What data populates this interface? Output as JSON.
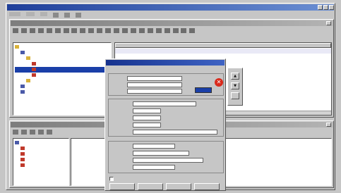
{
  "main_window": {
    "title": "",
    "menu": [],
    "toolbar_icon_count": 6
  },
  "inner_window": {
    "title": "",
    "menu": [],
    "toolbar_icon_count": 22,
    "address_label": "",
    "tree": [
      {
        "label": "",
        "level": 0,
        "icon": "folder-icon"
      },
      {
        "label": "",
        "level": 1,
        "icon": "computer-icon"
      },
      {
        "label": "",
        "level": 2,
        "icon": "folder-icon"
      },
      {
        "label": "",
        "level": 3,
        "icon": "document-icon"
      },
      {
        "label": "",
        "level": 3,
        "icon": "document-icon",
        "selected": true
      },
      {
        "label": "",
        "level": 3,
        "icon": "document-icon"
      },
      {
        "label": "",
        "level": 2,
        "icon": "folder-icon"
      },
      {
        "label": "",
        "level": 1,
        "icon": "computer-icon"
      },
      {
        "label": "",
        "level": 1,
        "icon": "computer-icon"
      }
    ],
    "table_headers": [
      "",
      "",
      "",
      "",
      ""
    ],
    "table_rows": [
      [
        "",
        "",
        "",
        "",
        ""
      ]
    ]
  },
  "lower_window": {
    "title": "",
    "menu": [],
    "tree": [
      {
        "label": "",
        "level": 0
      },
      {
        "label": "",
        "level": 1
      },
      {
        "label": "",
        "level": 1
      },
      {
        "label": "",
        "level": 1
      },
      {
        "label": "",
        "level": 1
      }
    ],
    "pane_text": ""
  },
  "dialog": {
    "title": "",
    "top_label": "",
    "fields_top": [
      {
        "label": "",
        "value": ""
      },
      {
        "label": "",
        "value": ""
      },
      {
        "label": "",
        "value": ""
      }
    ],
    "fields_mid": [
      {
        "label": "",
        "value": ""
      },
      {
        "label": "",
        "value": ""
      },
      {
        "label": "",
        "value": ""
      },
      {
        "label": "",
        "value": ""
      },
      {
        "label": "",
        "value": ""
      }
    ],
    "fields_bottom": [
      {
        "label": "",
        "value": ""
      },
      {
        "label": "",
        "value": ""
      },
      {
        "label": "",
        "value": ""
      },
      {
        "label": "",
        "value": ""
      }
    ],
    "checkbox_label": "",
    "buttons": [
      "",
      "",
      "",
      ""
    ]
  },
  "colors": {
    "title_active": "#2b5dbf",
    "title_inactive": "#8a8a8a",
    "dialog_title": "#1f3d99",
    "error_icon": "#d92a1c",
    "selection": "#1a3fa8"
  }
}
